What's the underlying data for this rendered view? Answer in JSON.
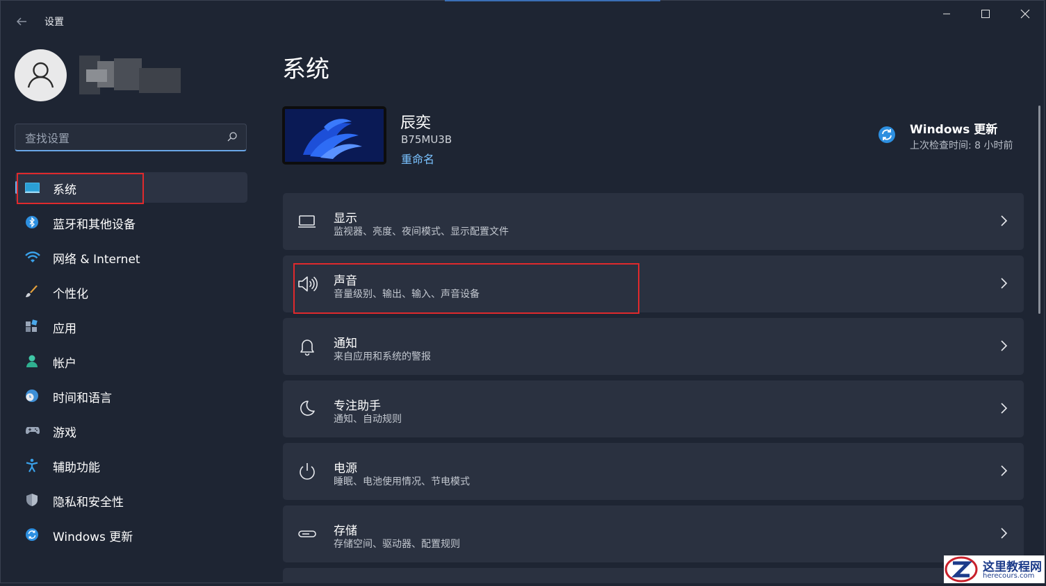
{
  "window": {
    "title": "设置"
  },
  "search": {
    "placeholder": "查找设置"
  },
  "nav": [
    {
      "label": "系统",
      "icon": "monitor-icon",
      "selected": true
    },
    {
      "label": "蓝牙和其他设备",
      "icon": "bluetooth-icon"
    },
    {
      "label": "网络 & Internet",
      "icon": "wifi-icon"
    },
    {
      "label": "个性化",
      "icon": "brush-icon"
    },
    {
      "label": "应用",
      "icon": "apps-icon"
    },
    {
      "label": "帐户",
      "icon": "person-icon"
    },
    {
      "label": "时间和语言",
      "icon": "globe-clock-icon"
    },
    {
      "label": "游戏",
      "icon": "gamepad-icon"
    },
    {
      "label": "辅助功能",
      "icon": "accessibility-icon"
    },
    {
      "label": "隐私和安全性",
      "icon": "shield-icon"
    },
    {
      "label": "Windows 更新",
      "icon": "update-icon"
    }
  ],
  "main": {
    "title": "系统",
    "device": {
      "name": "辰奕",
      "model": "B75MU3B",
      "rename_label": "重命名"
    },
    "update": {
      "title": "Windows 更新",
      "subtitle": "上次检查时间: 8 小时前"
    },
    "cards": [
      {
        "title": "显示",
        "subtitle": "监视器、亮度、夜间模式、显示配置文件",
        "icon": "display-icon"
      },
      {
        "title": "声音",
        "subtitle": "音量级别、输出、输入、声音设备",
        "icon": "speaker-icon"
      },
      {
        "title": "通知",
        "subtitle": "来自应用和系统的警报",
        "icon": "bell-icon"
      },
      {
        "title": "专注助手",
        "subtitle": "通知、自动规则",
        "icon": "moon-icon"
      },
      {
        "title": "电源",
        "subtitle": "睡眠、电池使用情况、节电模式",
        "icon": "power-icon"
      },
      {
        "title": "存储",
        "subtitle": "存储空间、驱动器、配置规则",
        "icon": "storage-icon"
      }
    ]
  },
  "watermark": {
    "name": "这里教程网",
    "url": "herecours.com"
  },
  "colors": {
    "accent": "#6ab4f0",
    "link": "#7ac2ff",
    "highlight_box": "#e0292c",
    "background": "#1e2533",
    "card": "#2a3140"
  }
}
